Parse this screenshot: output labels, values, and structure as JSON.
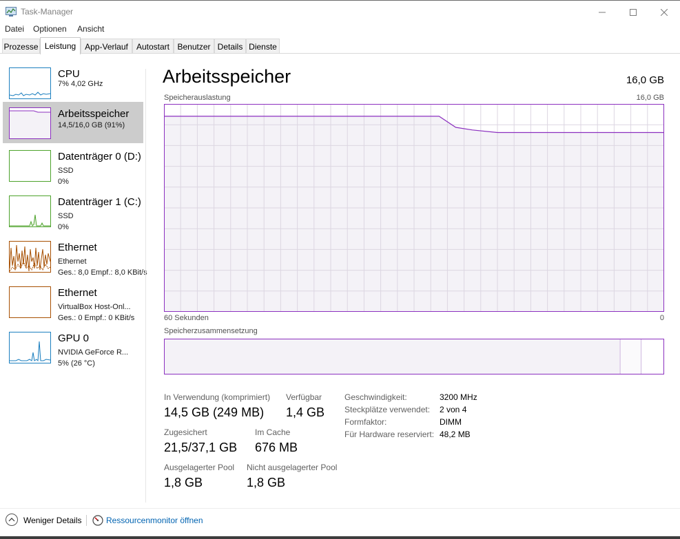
{
  "window": {
    "title": "Task-Manager",
    "controls": [
      "minimize",
      "maximize",
      "close"
    ]
  },
  "menu": [
    "Datei",
    "Optionen",
    "Ansicht"
  ],
  "tabs": [
    "Prozesse",
    "Leistung",
    "App-Verlauf",
    "Autostart",
    "Benutzer",
    "Details",
    "Dienste"
  ],
  "active_tab": "Leistung",
  "sidebar": [
    {
      "title": "CPU",
      "sub1": "7% 4,02 GHz",
      "sub2": "",
      "color": "#1b7fbf",
      "selected": false
    },
    {
      "title": "Arbeitsspeicher",
      "sub1": "14,5/16,0 GB (91%)",
      "sub2": "",
      "color": "#8b2fbf",
      "selected": true
    },
    {
      "title": "Datenträger 0 (D:)",
      "sub1": "SSD",
      "sub2": "0%",
      "color": "#4ca22a",
      "selected": false
    },
    {
      "title": "Datenträger 1 (C:)",
      "sub1": "SSD",
      "sub2": "0%",
      "color": "#4ca22a",
      "selected": false
    },
    {
      "title": "Ethernet",
      "sub1": "Ethernet",
      "sub2": "Ges.: 8,0  Empf.: 8,0 KBit/s",
      "color": "#a74f01",
      "selected": false
    },
    {
      "title": "Ethernet",
      "sub1": "VirtualBox Host-Onl...",
      "sub2": "Ges.: 0  Empf.: 0 KBit/s",
      "color": "#a74f01",
      "selected": false
    },
    {
      "title": "GPU 0",
      "sub1": "NVIDIA GeForce R...",
      "sub2": "5%  (26 °C)",
      "color": "#1b7fbf",
      "selected": false
    }
  ],
  "main": {
    "title": "Arbeitsspeicher",
    "total": "16,0 GB",
    "usage_label": "Speicherauslastung",
    "usage_max": "16,0 GB",
    "time_left": "60 Sekunden",
    "time_right": "0",
    "composition_label": "Speicherzusammensetzung"
  },
  "chart_data": {
    "type": "area",
    "x": [
      60,
      54,
      48,
      42,
      36,
      30,
      27,
      25,
      23,
      20,
      18,
      0
    ],
    "values": [
      15.05,
      15.05,
      15.05,
      15.05,
      15.05,
      15.05,
      15.05,
      14.2,
      14.0,
      13.8,
      13.8,
      13.8
    ],
    "ylim": [
      0,
      16
    ],
    "xlim": [
      60,
      0
    ],
    "grid": true,
    "color": "#8b2fbf",
    "fill": "#f4f2f7"
  },
  "composition": {
    "in_use_fraction": 0.912,
    "modified_fraction": 0.042,
    "standby_fraction": 0.0,
    "free_fraction": 0.046
  },
  "stats": {
    "in_use_label": "In Verwendung (komprimiert)",
    "in_use_value": "14,5 GB (249 MB)",
    "available_label": "Verfügbar",
    "available_value": "1,4 GB",
    "committed_label": "Zugesichert",
    "committed_value": "21,5/37,1 GB",
    "cached_label": "Im Cache",
    "cached_value": "676 MB",
    "paged_label": "Ausgelagerter Pool",
    "paged_value": "1,8 GB",
    "nonpaged_label": "Nicht ausgelagerter Pool",
    "nonpaged_value": "1,8 GB"
  },
  "details": [
    {
      "key": "Geschwindigkeit:",
      "value": "3200 MHz"
    },
    {
      "key": "Steckplätze verwendet:",
      "value": "2 von 4"
    },
    {
      "key": "Formfaktor:",
      "value": "DIMM"
    },
    {
      "key": "Für Hardware reserviert:",
      "value": "48,2 MB"
    }
  ],
  "footer": {
    "less_details": "Weniger Details",
    "resource_monitor": "Ressourcenmonitor öffnen"
  }
}
